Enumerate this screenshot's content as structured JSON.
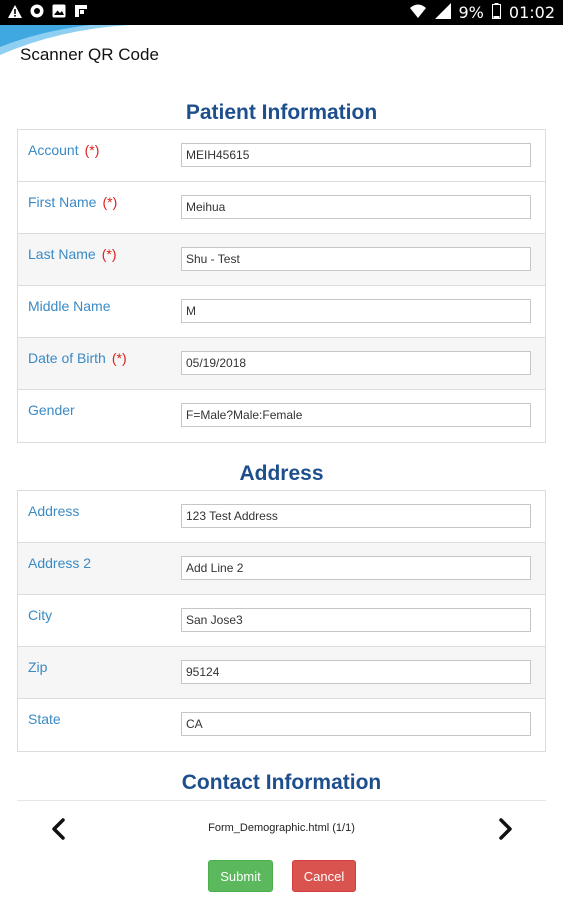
{
  "status_bar": {
    "icons_left": [
      "warning-icon",
      "app-icon",
      "image-icon",
      "flipboard-icon"
    ],
    "battery": "9%",
    "time": "01:02"
  },
  "app_bar": {
    "title": "Scanner QR Code"
  },
  "patient_section": {
    "title": "Patient Information",
    "fields": [
      {
        "label": "Account",
        "required": "(*)",
        "value": "MEIH45615"
      },
      {
        "label": "First Name",
        "required": "(*)",
        "value": "Meihua"
      },
      {
        "label": "Last Name",
        "required": "(*)",
        "value": "Shu - Test"
      },
      {
        "label": "Middle Name",
        "required": "",
        "value": "M"
      },
      {
        "label": "Date of Birth",
        "required": "(*)",
        "value": "05/19/2018"
      },
      {
        "label": "Gender",
        "required": "",
        "value": "F=Male?Male:Female"
      }
    ]
  },
  "address_section": {
    "title": "Address",
    "fields": [
      {
        "label": "Address",
        "value": "123 Test Address"
      },
      {
        "label": "Address 2",
        "value": "Add Line 2"
      },
      {
        "label": "City",
        "value": "San Jose3"
      },
      {
        "label": "Zip",
        "value": "95124"
      },
      {
        "label": "State",
        "value": "CA"
      }
    ]
  },
  "contact_section": {
    "title": "Contact Information"
  },
  "navigation": {
    "file_name": "Form_Demographic.html (1/1)"
  },
  "actions": {
    "submit_label": "Submit",
    "cancel_label": "Cancel"
  },
  "colors": {
    "section_title": "#1d4f8c",
    "label": "#3a8ac5",
    "required": "#d9201c",
    "submit": "#5cb85c",
    "cancel": "#d9534f"
  }
}
